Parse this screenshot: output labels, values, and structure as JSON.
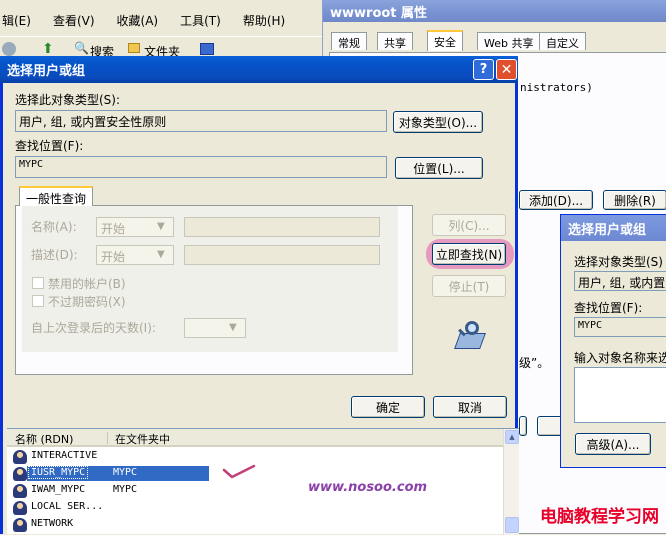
{
  "explorer": {
    "menu": [
      "辑(E)",
      "查看(V)",
      "收藏(A)",
      "工具(T)",
      "帮助(H)"
    ],
    "toolbar": [
      "搜索",
      "文件夹"
    ]
  },
  "properties": {
    "title": "wwwroot 属性",
    "tabs": [
      "常规",
      "共享",
      "安全",
      "Web 共享",
      "自定义"
    ],
    "partial_text": "nistrators)",
    "add_label": "添加(D)...",
    "remove_label": "删除(R)",
    "partial_note": "级”。"
  },
  "dialog": {
    "title": "选择用户或组",
    "object_type_label": "选择此对象类型(S):",
    "object_type_value": "用户, 组, 或内置安全性原则",
    "object_type_button": "对象类型(O)...",
    "location_label": "查找位置(F):",
    "location_value": "MYPC",
    "location_button": "位置(L)...",
    "tab_label": "一般性查询",
    "name_label": "名称(A):",
    "name_mode": "开始",
    "desc_label": "描述(D):",
    "desc_mode": "开始",
    "disabled_accounts": "禁用的帐户(B)",
    "non_expiring": "不过期密码(X)",
    "days_label": "自上次登录后的天数(I):",
    "columns_button": "列(C)...",
    "find_now_button": "立即查找(N)",
    "stop_button": "停止(T)",
    "ok_button": "确定",
    "cancel_button": "取消",
    "results": {
      "headers": [
        "名称 (RDN)",
        "在文件夹中"
      ],
      "rows": [
        {
          "name": "INTERACTIVE",
          "folder": ""
        },
        {
          "name": "IUSR_MYPC",
          "folder": "MYPC"
        },
        {
          "name": "IWAM_MYPC",
          "folder": "MYPC"
        },
        {
          "name": "LOCAL SER...",
          "folder": ""
        },
        {
          "name": "NETWORK",
          "folder": ""
        }
      ]
    }
  },
  "dialog2": {
    "title": "选择用户或组",
    "object_type_label": "选择对象类型(S)",
    "object_type_value": "用户, 组, 或内置安",
    "location_label": "查找位置(F):",
    "location_value": "MYPC",
    "enter_label": "输入对象名称来选",
    "advanced_button": "高级(A)..."
  },
  "watermarks": {
    "url": "www.nosoo.com",
    "site": "电脑教程学习网"
  },
  "colors": {
    "title_blue": "#0a4bbd",
    "selection": "#316ac5",
    "highlight_circle": "#c0407a",
    "watermark_red": "#e8002a",
    "watermark_purple": "#8b3fa8"
  }
}
